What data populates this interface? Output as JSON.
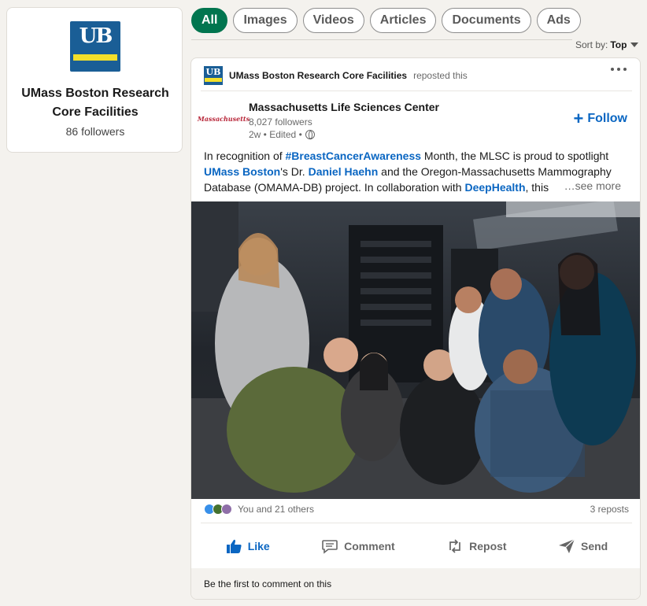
{
  "profile": {
    "logo_letters": "UB",
    "name": "UMass Boston Research Core Facilities",
    "followers": "86 followers"
  },
  "filters": [
    "All",
    "Images",
    "Videos",
    "Articles",
    "Documents",
    "Ads"
  ],
  "sort": {
    "label": "Sort by:",
    "value": "Top"
  },
  "post": {
    "reposter_name": "UMass Boston Research Core Facilities",
    "reposter_action": "reposted this",
    "author_logo_text": "Massachusetts",
    "author_name": "Massachusetts Life Sciences Center",
    "author_followers": "8,027 followers",
    "author_meta": "2w • Edited •",
    "follow_label": "Follow",
    "text": {
      "p1": "In recognition of ",
      "hashtag": "#BreastCancerAwareness",
      "p2": " Month, the MLSC is proud to spotlight ",
      "mention1": "UMass Boston",
      "p3": "'s Dr. ",
      "mention2": "Daniel Haehn",
      "p4": " and the Oregon-Massachusetts Mammography Database (OMAMA-DB) project. In collaboration with ",
      "mention3": "DeepHealth",
      "p5": ", this"
    },
    "see_more": "…see more",
    "reactions_text": "You and 21 others",
    "reposts": "3 reposts",
    "actions": {
      "like": "Like",
      "comment": "Comment",
      "repost": "Repost",
      "send": "Send"
    },
    "comment_prompt": "Be the first to comment on this"
  },
  "colors": {
    "accent": "#01754f",
    "link": "#0a66c2",
    "background": "#f4f2ee"
  }
}
